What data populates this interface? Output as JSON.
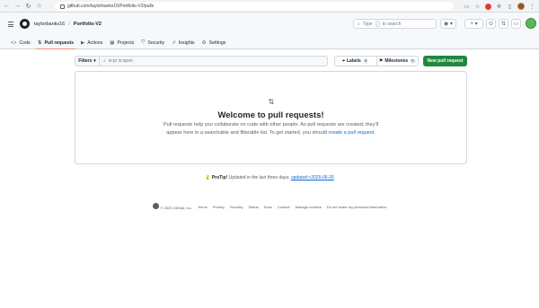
{
  "browser": {
    "url": "github.com/taylorbanks16/Portfolio-V2/pulls"
  },
  "header": {
    "owner": "taylorbanks16",
    "separator": "/",
    "repo": "Portfolio-V2",
    "search": {
      "text_before": "Type",
      "key": "/",
      "text_after": "to search"
    }
  },
  "tabs": [
    {
      "label": "Code",
      "icon": "code-icon"
    },
    {
      "label": "Pull requests",
      "icon": "git-pull-request-icon",
      "active": true
    },
    {
      "label": "Actions",
      "icon": "play-icon"
    },
    {
      "label": "Projects",
      "icon": "table-icon"
    },
    {
      "label": "Security",
      "icon": "shield-icon"
    },
    {
      "label": "Insights",
      "icon": "graph-icon"
    },
    {
      "label": "Settings",
      "icon": "gear-icon"
    }
  ],
  "toolbar": {
    "filters_label": "Filters",
    "filter_value": "is:pr is:open",
    "labels_label": "Labels",
    "labels_count": "0",
    "milestones_label": "Milestones",
    "milestones_count": "0",
    "new_pr_label": "New pull request"
  },
  "blankslate": {
    "title": "Welcome to pull requests!",
    "text_1": "Pull requests help you collaborate on code with other people. As pull requests are created, they'll appear here in a searchable and filterable list. To get started, you should",
    "link": "create a pull request",
    "text_2": "."
  },
  "protip": {
    "label": "ProTip!",
    "text": "Updated in the last three days:",
    "link": "updated:>2025-06-26"
  },
  "footer": {
    "copyright": "© 2025 GitHub, Inc.",
    "links": [
      "Terms",
      "Privacy",
      "Security",
      "Status",
      "Docs",
      "Contact",
      "Manage cookies",
      "Do not share my personal information"
    ]
  },
  "colors": {
    "accent": "#0969da",
    "primary_button": "#1f883d",
    "active_tab_underline": "#fd8c73"
  }
}
